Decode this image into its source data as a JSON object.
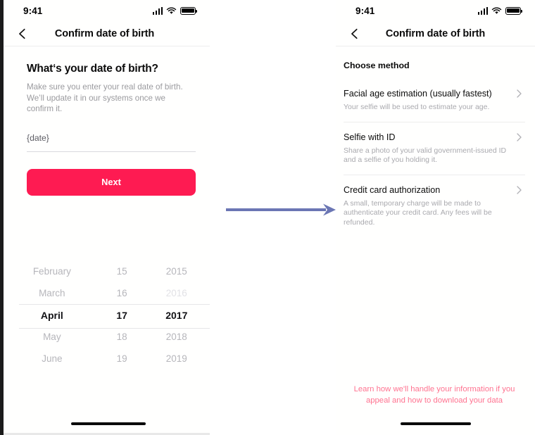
{
  "screens": {
    "left": {
      "status_bar": {
        "time": "9:41",
        "signal_icon": "cellular-signal-icon",
        "wifi_icon": "wifi-icon",
        "battery_icon": "battery-icon"
      },
      "nav": {
        "back_icon": "chevron-left-icon",
        "title": "Confirm date of birth"
      },
      "heading": "What‘s your date of birth?",
      "subtext": "Make sure you enter your real date of birth. We’ll update it in our systems once we confirm it.",
      "date_field_value": "{date}",
      "next_label": "Next",
      "picker": {
        "rows": [
          {
            "month": "February",
            "day": "15",
            "year": "2015",
            "selected": false,
            "year_faded": false
          },
          {
            "month": "March",
            "day": "16",
            "year": "2016",
            "selected": false,
            "year_faded": true
          },
          {
            "month": "April",
            "day": "17",
            "year": "2017",
            "selected": true,
            "year_faded": false
          },
          {
            "month": "May",
            "day": "18",
            "year": "2018",
            "selected": false,
            "year_faded": false
          },
          {
            "month": "June",
            "day": "19",
            "year": "2019",
            "selected": false,
            "year_faded": false
          }
        ],
        "selected_month": "April",
        "selected_day": "17",
        "selected_year": "2017"
      }
    },
    "right": {
      "status_bar": {
        "time": "9:41",
        "signal_icon": "cellular-signal-icon",
        "wifi_icon": "wifi-icon",
        "battery_icon": "battery-icon"
      },
      "nav": {
        "back_icon": "chevron-left-icon",
        "title": "Confirm date of birth"
      },
      "section_label": "Choose method",
      "methods": [
        {
          "title": "Facial age estimation (usually fastest)",
          "description": "Your selfie will be used to estimate your age.",
          "chevron_icon": "chevron-right-icon"
        },
        {
          "title": "Selfie with ID",
          "description": "Share a photo of your valid government-issued ID and a selfie of you holding it.",
          "chevron_icon": "chevron-right-icon"
        },
        {
          "title": "Credit card authorization",
          "description": "A small, temporary charge will be made to authenticate your credit card. Any fees will be refunded.",
          "chevron_icon": "chevron-right-icon"
        }
      ],
      "footer_link": "Learn how we'll handle your information if you appeal and how to download your data"
    }
  },
  "connector": {
    "icon": "right-arrow-icon"
  },
  "colors": {
    "primary_button": "#fe1b52",
    "footer_link": "#ff7390",
    "arrow": "#6b76b4",
    "text_primary": "#0b0b0b",
    "text_muted": "#a9a9ae"
  }
}
